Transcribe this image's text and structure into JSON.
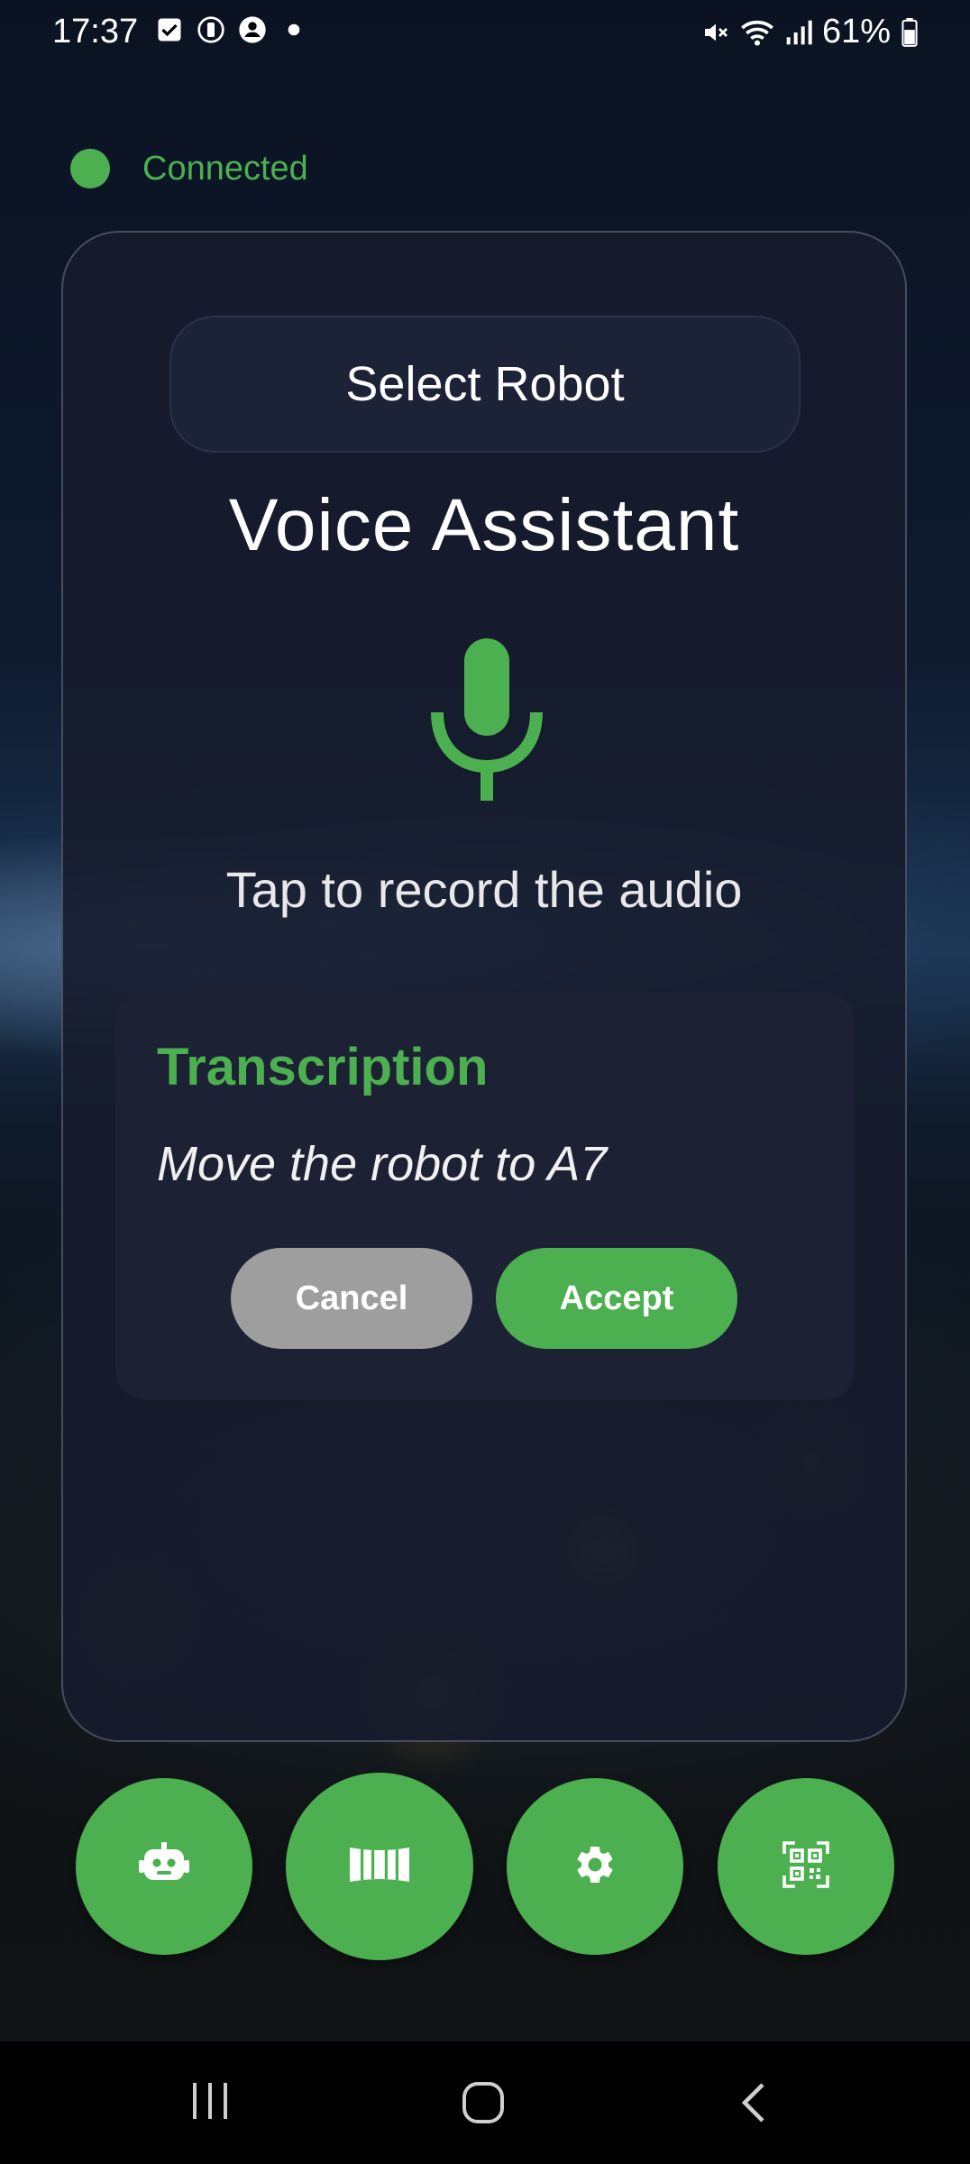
{
  "status_bar": {
    "time": "17:37",
    "battery": "61%",
    "icons": [
      "check-box-icon",
      "app-timer-icon",
      "account-circle-icon",
      "dot-icon",
      "mute-icon",
      "wifi-icon",
      "signal-icon",
      "battery-icon"
    ]
  },
  "connection": {
    "status": "Connected",
    "color": "#4caf50"
  },
  "main": {
    "select_robot_label": "Select Robot",
    "title": "Voice Assistant",
    "mic_icon": "microphone-icon",
    "hint": "Tap to record the audio",
    "transcription": {
      "heading": "Transcription",
      "text": "Move the robot to A7",
      "cancel_label": "Cancel",
      "accept_label": "Accept"
    }
  },
  "actions": [
    {
      "icon": "robot-icon"
    },
    {
      "icon": "panorama-icon"
    },
    {
      "icon": "settings-icon"
    },
    {
      "icon": "qr-code-scanner-icon"
    }
  ],
  "navigation": [
    "recent-apps-icon",
    "home-icon",
    "back-icon"
  ],
  "colors": {
    "accent": "#4caf50",
    "card": "#161c2c",
    "cancel": "#9e9e9e"
  }
}
